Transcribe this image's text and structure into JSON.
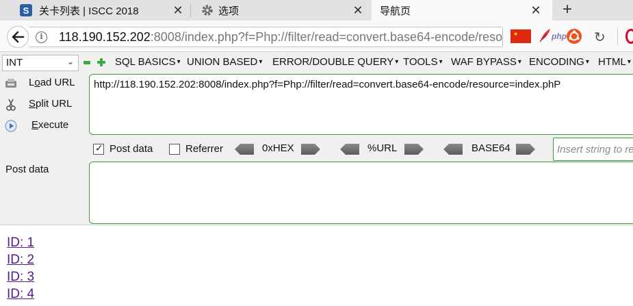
{
  "browser": {
    "tabs": [
      {
        "title": "关卡列表 | ISCC 2018",
        "favicon": "iscc-icon",
        "active": false
      },
      {
        "title": "选项",
        "favicon": "gear-icon",
        "active": false
      },
      {
        "title": "导航页",
        "favicon": "",
        "active": true
      }
    ],
    "url": {
      "host": "118.190.152.202",
      "rest": ":8008/index.php?f=Php://filter/read=convert.base64-encode/resource=index.phP"
    }
  },
  "hackbar": {
    "select_value": "INT",
    "menus": [
      "SQL BASICS",
      "UNION BASED",
      "ERROR/DOUBLE QUERY",
      "TOOLS",
      "WAF BYPASS",
      "ENCODING",
      "HTML"
    ],
    "actions": {
      "load_pre": "L",
      "load_u": "o",
      "load_post": "ad URL",
      "split_pre": "",
      "split_u": "S",
      "split_post": "plit URL",
      "exec_pre": "",
      "exec_u": "E",
      "exec_post": "xecute"
    },
    "url_value": "http://118.190.152.202:8008/index.php?f=Php://filter/read=convert.base64-encode/resource=index.phP",
    "post_data_checkbox": "Post data",
    "post_data_checked": true,
    "referrer_checkbox": "Referrer",
    "referrer_checked": false,
    "encoders": [
      "0xHEX",
      "%URL",
      "BASE64"
    ],
    "insert_placeholder": "Insert string to replace",
    "post_label": "Post data",
    "post_value": ""
  },
  "page": {
    "links": [
      "ID: 1",
      "ID: 2",
      "ID: 3",
      "ID: 4"
    ]
  },
  "colors": {
    "link": "#551a8b",
    "hackbar_border": "#3b9b3b",
    "tab_strip": "#e2e2e2"
  }
}
